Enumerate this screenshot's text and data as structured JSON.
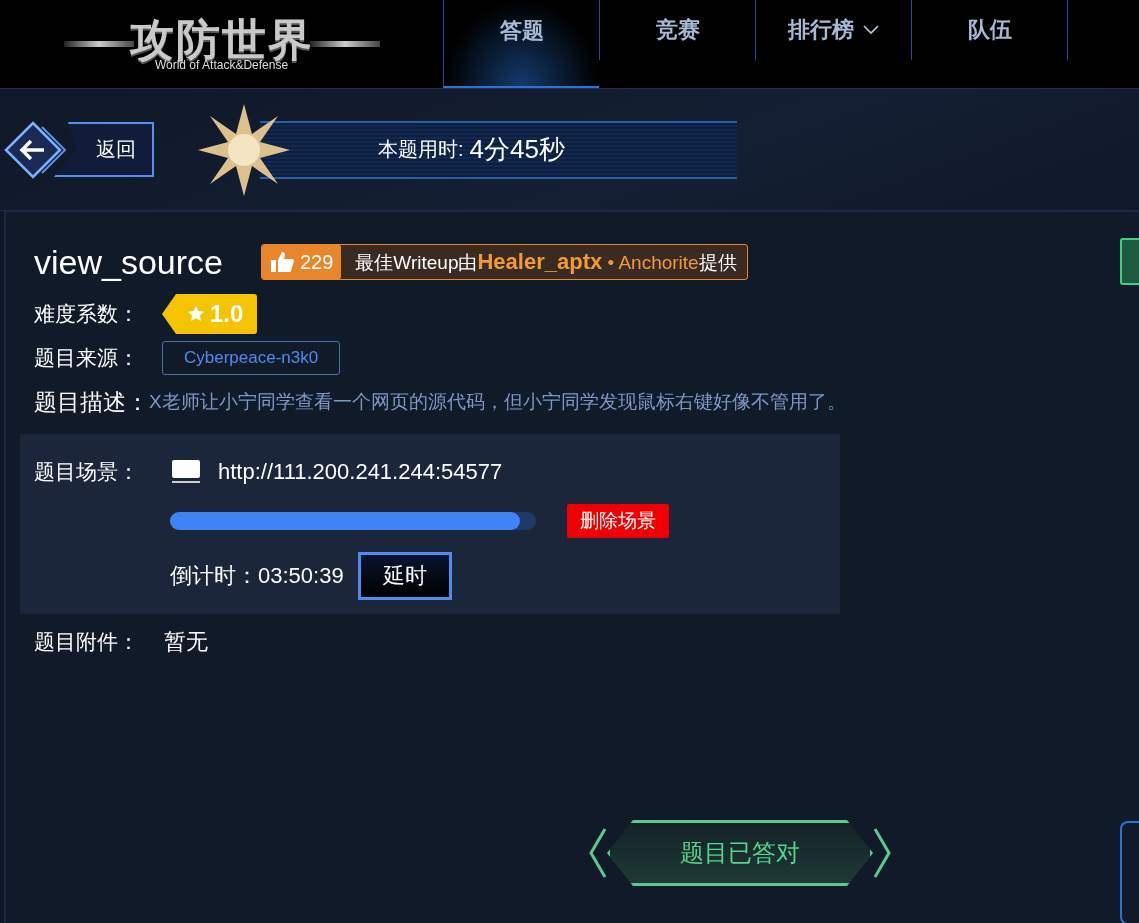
{
  "logo": {
    "title": "攻防世界",
    "subtitle": "World of Attack&Defense"
  },
  "nav": [
    {
      "label": "答题",
      "selected": true,
      "dropdown": false
    },
    {
      "label": "竞赛",
      "selected": false,
      "dropdown": false
    },
    {
      "label": "排行榜",
      "selected": false,
      "dropdown": true
    },
    {
      "label": "队伍",
      "selected": false,
      "dropdown": false
    }
  ],
  "back_button": "返回",
  "timer": {
    "label": "本题用时:",
    "value": "4分45秒"
  },
  "challenge": {
    "title": "view_source",
    "likes": "229",
    "writeup": "最佳Writeup由",
    "author": "Healer_aptx",
    "separator": "•",
    "team": "Anchorite",
    "suffix": "提供",
    "difficulty_label": "难度系数：",
    "difficulty": "1.0",
    "source_label": "题目来源：",
    "source": "Cyberpeace-n3k0",
    "description_label": "题目描述：",
    "description": "X老师让小宁同学查看一个网页的源代码，但小宁同学发现鼠标右键好像不管用了。",
    "scene_label": "题目场景：",
    "scene_url": "http://111.200.241.244:54577",
    "level": 0.956,
    "delete_button": "删除场景",
    "countdown_label": "倒计时：",
    "countdown": "03:50:39",
    "extend_button": "延时",
    "attachment_label": "题目附件：",
    "attachment": "暂无",
    "status_button": "题目已答对"
  }
}
